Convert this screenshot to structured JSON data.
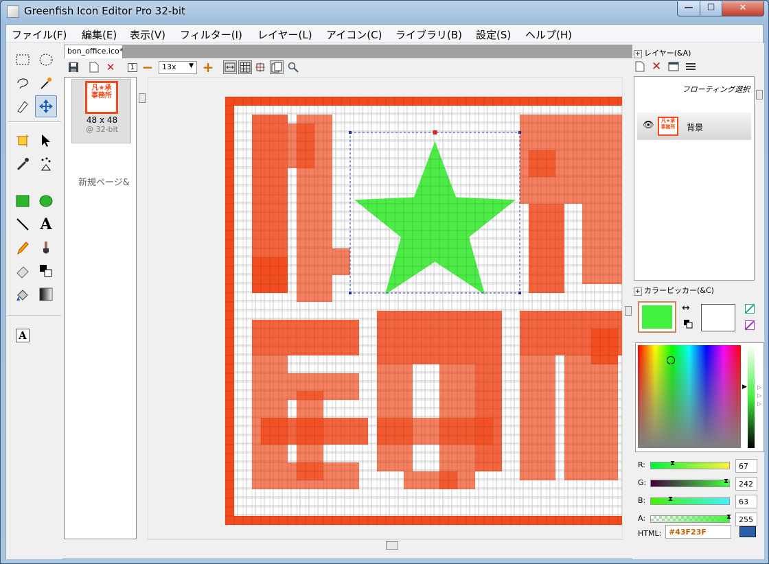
{
  "window": {
    "title": "Greenfish Icon Editor Pro 32-bit",
    "min": "—",
    "max": "☐",
    "close": "✕"
  },
  "menu": [
    "ファイル(F)",
    "編集(E)",
    "表示(V)",
    "フィルター(I)",
    "レイヤー(L)",
    "アイコン(C)",
    "ライブラリ(B)",
    "設定(S)",
    "ヘルプ(H)"
  ],
  "tab": {
    "label": "bon_office.ico*"
  },
  "doc_toolbar": {
    "zoom": "13x",
    "page_num": "1"
  },
  "pages": {
    "thumb_size": "48 x 48",
    "thumb_depth": "@ 32-bit",
    "new_page": "新規ページ&",
    "thumb_text_1": "凡★承",
    "thumb_text_2": "事務所"
  },
  "layers": {
    "title": "レイヤー(&A)",
    "floating": "フローティング選択",
    "layer_name": "背景"
  },
  "color": {
    "title": "カラーピッカー(&C)",
    "r_label": "R:",
    "g_label": "G:",
    "b_label": "B:",
    "a_label": "A:",
    "r": "67",
    "g": "242",
    "b": "63",
    "a": "255",
    "html_label": "HTML:",
    "html": "#43F23F",
    "primary": "#43F23F",
    "secondary": "#FFFFFF"
  },
  "canvas": {
    "grid": 48,
    "border_color": "#F14A1C",
    "text_color": "#F14A1C",
    "star_color": "#4CEB46"
  }
}
